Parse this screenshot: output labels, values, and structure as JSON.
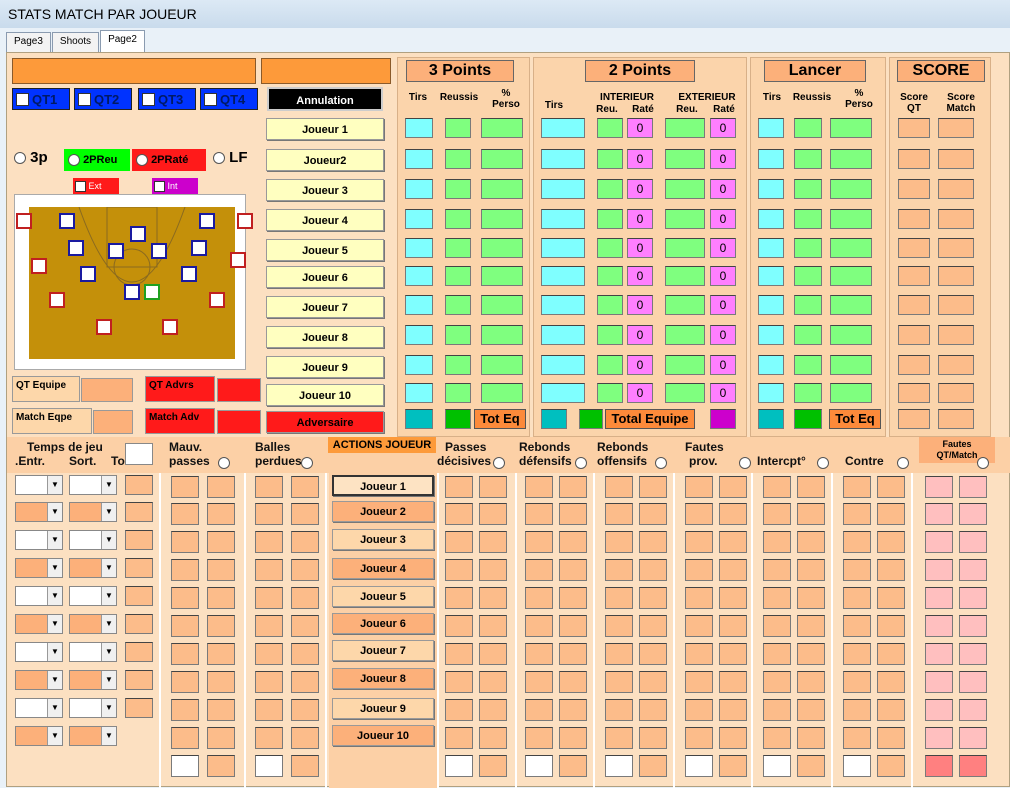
{
  "window": {
    "title": "STATS MATCH PAR JOUEUR"
  },
  "tabs": [
    "Page3",
    "Shoots",
    "Page2"
  ],
  "quarters": [
    "QT1",
    "QT2",
    "QT3",
    "QT4"
  ],
  "annulation": "Annulation",
  "shot_types": {
    "p3": "3p",
    "p2reu": "2PReu",
    "p2rate": "2PRaté",
    "lf": "LF",
    "ext": "Ext",
    "int": "Int"
  },
  "players": [
    "Joueur 1",
    "Joueur2",
    "Joueur 3",
    "Joueur 4",
    "Joueur 5",
    "Joueur 6",
    "Joueur 7",
    "Joueur 8",
    "Joueur 9",
    "Joueur 10"
  ],
  "adversaire": "Adversaire",
  "qt_equipe": "QT Equipe",
  "qt_advrs": "QT Advrs",
  "match_eqpe": "Match Eqpe",
  "match_adv": "Match Adv",
  "sections": {
    "p3": {
      "title": "3  Points",
      "cols": [
        "Tirs",
        "Reussis",
        "%\nPerso"
      ],
      "tot": "Tot Eq"
    },
    "p2": {
      "title": "2 Points",
      "tirs": "Tirs",
      "interieur": "INTERIEUR",
      "exterieur": "EXTERIEUR",
      "reu": "Reu.",
      "rate": "Raté",
      "tot": "Total Equipe"
    },
    "lancer": {
      "title": "Lancer",
      "cols": [
        "Tirs",
        "Reussis",
        "%\nPerso"
      ],
      "tot": "Tot Eq"
    },
    "score": {
      "title": "SCORE",
      "cols": [
        "Score\nQT",
        "Score\nMatch"
      ]
    }
  },
  "zero": "0",
  "bottom": {
    "temps": "Temps de jeu",
    "entr": ".Entr.",
    "sort": "Sort.",
    "tot": "To",
    "mauv": "Mauv.",
    "passes": "passes",
    "balles": "Balles",
    "perdues": "perdues",
    "actions": "ACTIONS JOUEUR",
    "passes_dec": "Passes",
    "decisives": "décisives",
    "reb_def": "Rebonds",
    "defensifs": "défensifs",
    "reb_off": "Rebonds",
    "offensifs": "offensifs",
    "fautes": "Fautes",
    "prov": "prov.",
    "intercept": "Intercpt°",
    "contre": "Contre",
    "fautes_qt": "Fautes\nQT/Match"
  },
  "action_players": [
    "Joueur 1",
    "Joueur 2",
    "Joueur 3",
    "Joueur 4",
    "Joueur 5",
    "Joueur 6",
    "Joueur 7",
    "Joueur 8",
    "Joueur 9",
    "Joueur 10"
  ]
}
